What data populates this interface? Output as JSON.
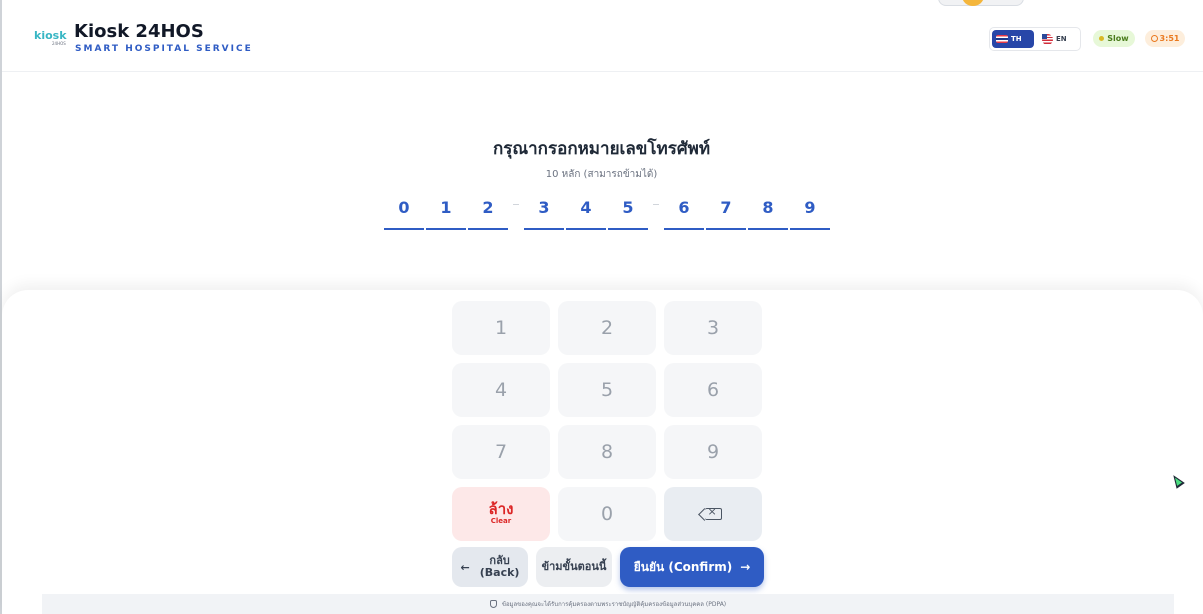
{
  "header": {
    "logo_text": "kiosk",
    "logo_sub": "24HOS",
    "title": "Kiosk 24HOS",
    "subtitle": "SMART HOSPITAL SERVICE",
    "lang_th": "TH",
    "lang_en": "EN",
    "status": "Slow",
    "timer": "3:51",
    "colors": {
      "brand": "#2f5cc4",
      "lang_active": "#2746a8",
      "status_bg": "#e7f8d8",
      "timer": "#ea7a20"
    }
  },
  "phone": {
    "title": "กรุณากรอกหมายเลขโทรศัพท์",
    "hint": "10 หลัก (สามารถข้ามได้)",
    "digits": [
      "0",
      "1",
      "2",
      "3",
      "4",
      "5",
      "6",
      "7",
      "8",
      "9"
    ]
  },
  "keypad": {
    "keys": [
      "1",
      "2",
      "3",
      "4",
      "5",
      "6",
      "7",
      "8",
      "9"
    ],
    "zero": "0",
    "clear_th": "ล้าง",
    "clear_en": "Clear",
    "backspace_icon": "backspace-icon"
  },
  "actions": {
    "back_arrow": "←",
    "back_label": "กลับ\n(Back)",
    "skip_label": "ข้ามขั้นตอนนี้",
    "confirm_label": "ยืนยัน (Confirm)",
    "confirm_arrow": "→",
    "confirm_color": "#2f5cc4"
  },
  "footer": {
    "text": "ข้อมูลของคุณจะได้รับการคุ้มครองตามพระราชบัญญัติคุ้มครองข้อมูลส่วนบุคคล (PDPA)"
  }
}
